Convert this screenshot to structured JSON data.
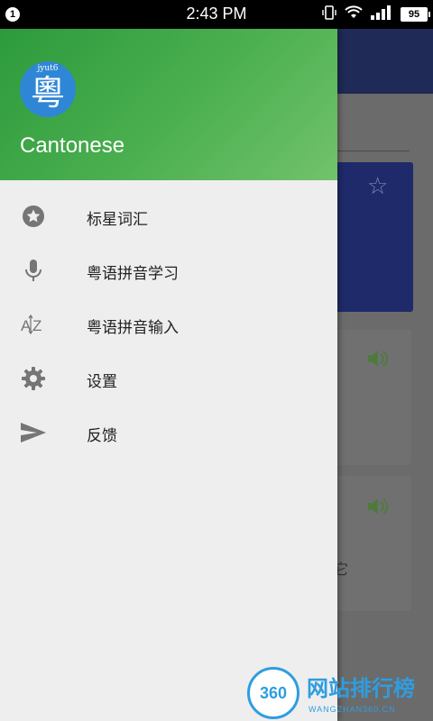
{
  "status_bar": {
    "notification_count": "1",
    "time": "2:43 PM",
    "battery": "95",
    "icons": [
      "vibrate-icon",
      "wifi-icon",
      "signal-icon",
      "battery-icon"
    ]
  },
  "drawer": {
    "header": {
      "avatar_small_text": "jyut6",
      "avatar_char": "粵",
      "app_name": "Cantonese"
    },
    "items": [
      {
        "label": "标星词汇",
        "icon": "star-icon"
      },
      {
        "label": "粤语拼音学习",
        "icon": "microphone-icon"
      },
      {
        "label": "粤语拼音输入",
        "icon": "az-sort-icon"
      },
      {
        "label": "设置",
        "icon": "gear-icon"
      },
      {
        "label": "反馈",
        "icon": "send-icon"
      }
    ]
  },
  "background_app": {
    "partial_char": "它"
  },
  "watermark": {
    "logo": "360",
    "title": "网站排行榜",
    "subtitle": "WANGZHAN360.CN"
  },
  "colors": {
    "header_green": "#4cb050",
    "avatar_blue": "#2f86d6",
    "drawer_bg": "#eeeeee",
    "toolbar_navy": "#1f2a56"
  }
}
